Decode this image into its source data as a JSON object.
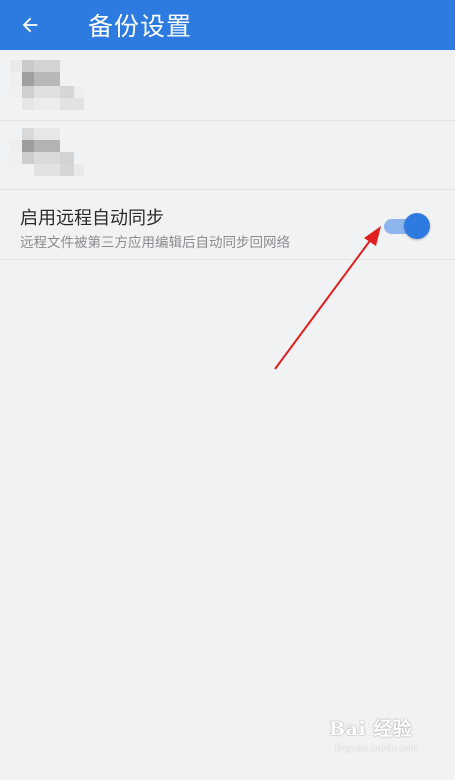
{
  "appbar": {
    "title": "备份设置",
    "back_icon": "arrow-left-icon",
    "color": "#2d7be0"
  },
  "rows": [
    {
      "kind": "redacted"
    },
    {
      "kind": "redacted"
    },
    {
      "kind": "toggle",
      "title": "启用远程自动同步",
      "subtitle": "远程文件被第三方应用编辑后自动同步回网络",
      "toggle_on": true
    }
  ],
  "annotation": {
    "type": "red-arrow",
    "color": "#e02020",
    "points_to": "auto-sync-toggle"
  },
  "watermark": {
    "logo": "Bai 经验",
    "url": "jingyan.baidu.com"
  }
}
